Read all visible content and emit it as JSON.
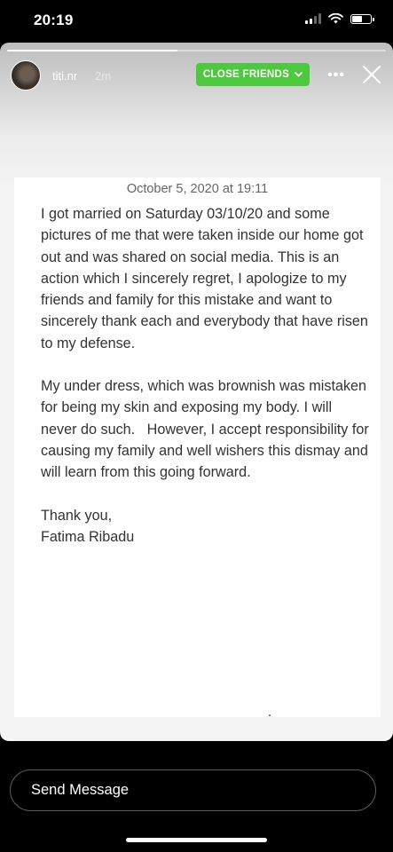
{
  "status_bar": {
    "time": "20:19",
    "battery_level": 0.6
  },
  "story": {
    "progress": 0.45,
    "username": "titi.nr",
    "time_ago": "2m",
    "close_friends_label": "CLOSE FRIENDS",
    "accent_color": "#4ec83e"
  },
  "note": {
    "date": "October 5, 2020 at 19:11",
    "paragraphs": [
      "I got married on Saturday 03/10/20 and some pictures of me that were taken inside our home got out and was shared on social media. This is an action which I sincerely regret, I apologize to my friends and family for this mistake and want to sincerely thank each and everybody that have risen to my defense.",
      "My under dress, which was brownish was mistaken for being my skin and exposing my body. I will never do such.   However, I accept responsibility for causing my family and well wishers this dismay and will learn from this going forward."
    ],
    "signoff": "Thank you,",
    "signature": "Fatima Ribadu"
  },
  "footer": {
    "send_message_placeholder": "Send Message"
  }
}
